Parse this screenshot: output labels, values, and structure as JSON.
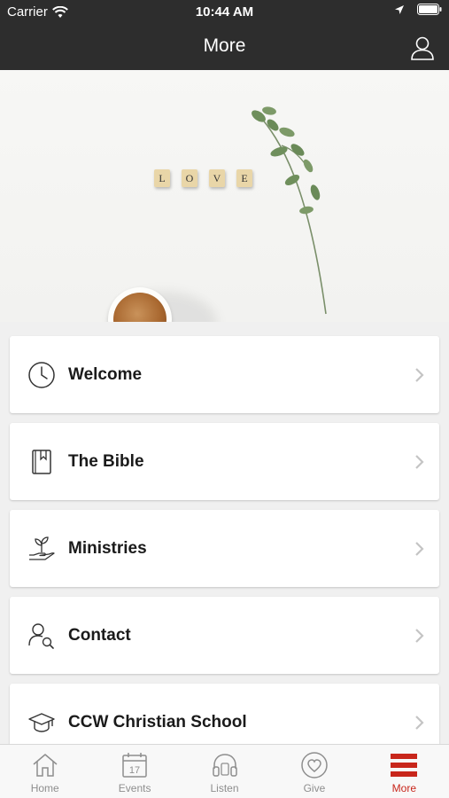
{
  "status_bar": {
    "carrier": "Carrier",
    "time": "10:44 AM"
  },
  "nav": {
    "title": "More"
  },
  "hero": {
    "tiles": [
      "L",
      "O",
      "V",
      "E"
    ]
  },
  "menu": {
    "items": [
      {
        "label": "Welcome",
        "icon": "clock-icon"
      },
      {
        "label": "The Bible",
        "icon": "bible-icon"
      },
      {
        "label": "Ministries",
        "icon": "plant-hand-icon"
      },
      {
        "label": "Contact",
        "icon": "contact-search-icon"
      },
      {
        "label": "CCW Christian School",
        "icon": "graduation-cap-icon"
      }
    ]
  },
  "tabs": [
    {
      "label": "Home",
      "icon": "home-icon",
      "active": false
    },
    {
      "label": "Events",
      "icon": "calendar-icon",
      "calendar_day": "17",
      "active": false
    },
    {
      "label": "Listen",
      "icon": "headphones-icon",
      "active": false
    },
    {
      "label": "Give",
      "icon": "heart-icon",
      "active": false
    },
    {
      "label": "More",
      "icon": "menu-icon",
      "active": true
    }
  ],
  "colors": {
    "bar": "#2d2d2d",
    "accent": "#c8261b",
    "tab_inactive": "#8e8e8e"
  }
}
